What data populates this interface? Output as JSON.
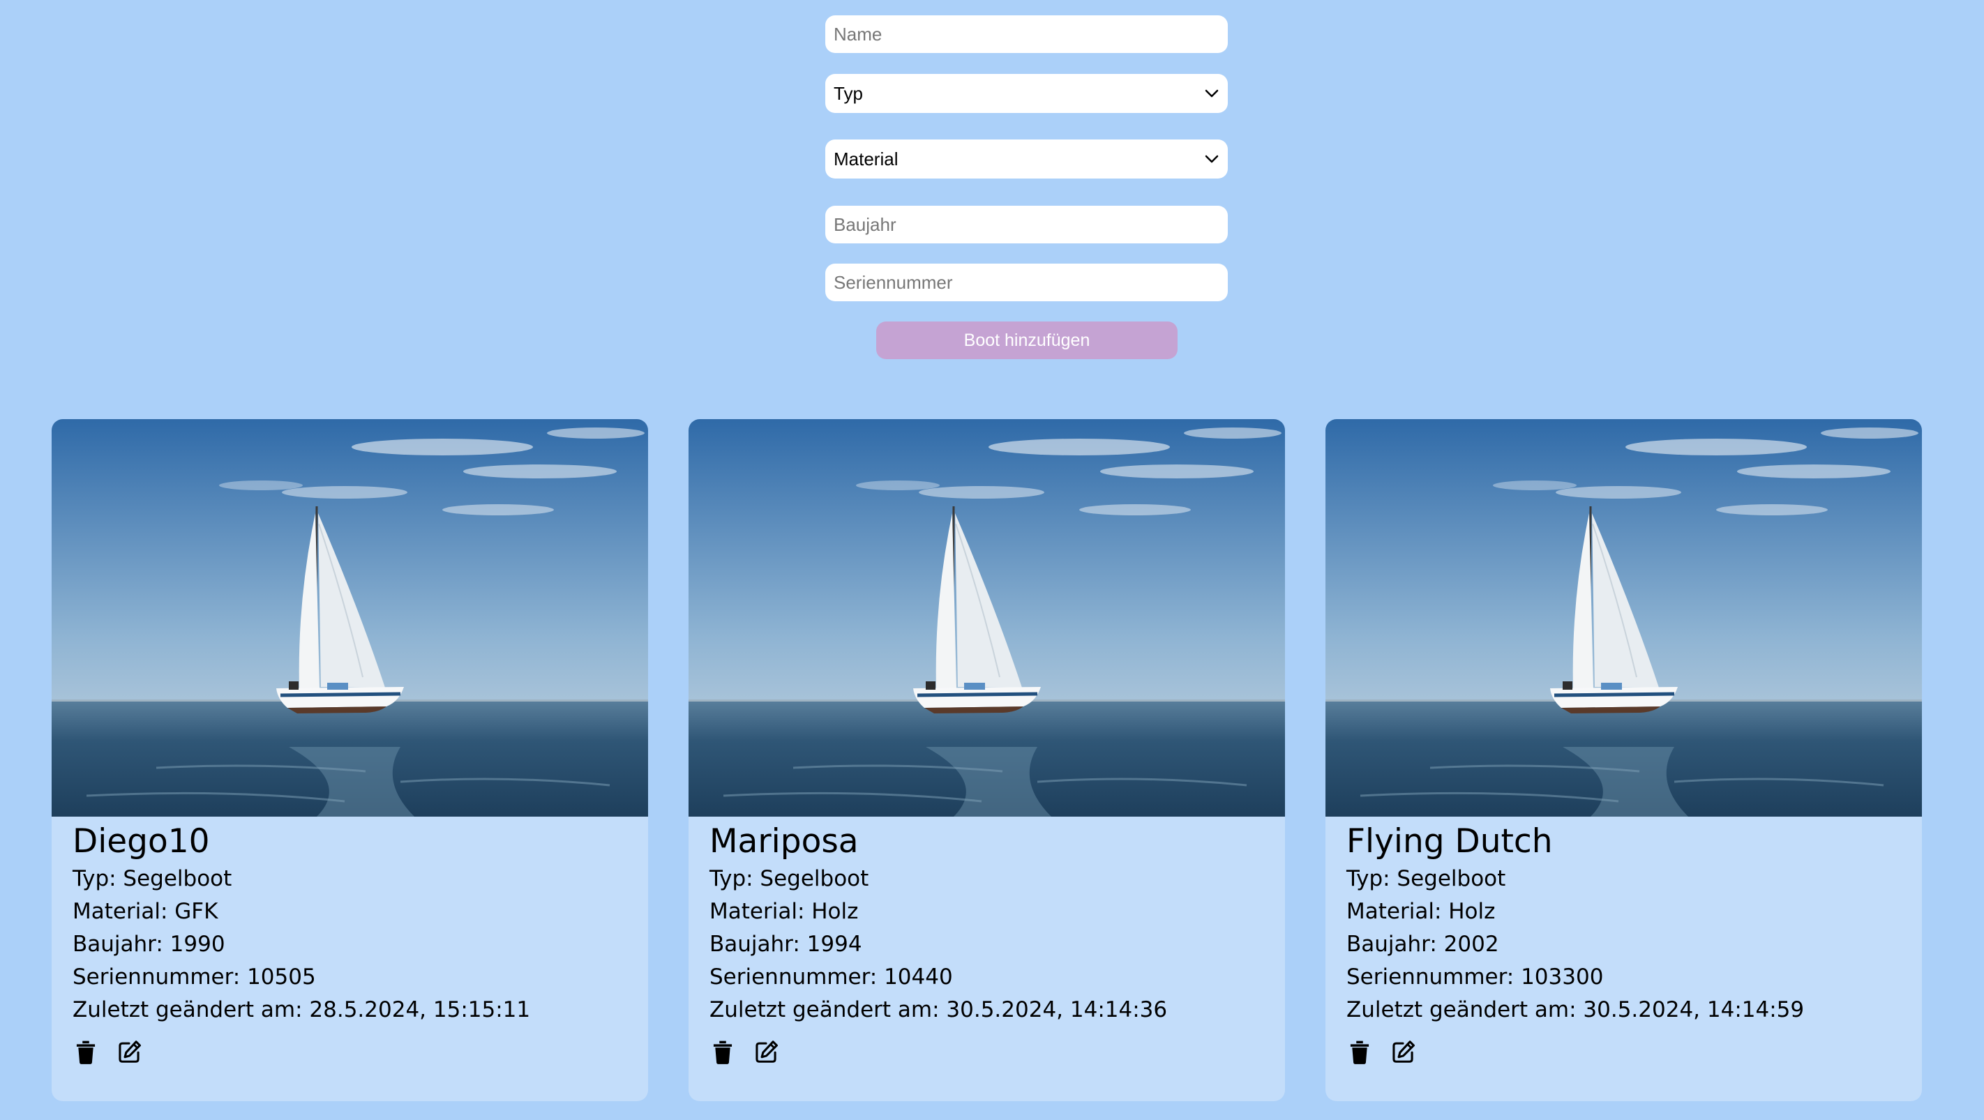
{
  "form": {
    "name_placeholder": "Name",
    "type_select": "Typ",
    "material_select": "Material",
    "year_placeholder": "Baujahr",
    "serial_placeholder": "Seriennummer",
    "submit_label": "Boot hinzufügen"
  },
  "colors": {
    "background": "#abd0f9",
    "card": "#c3ddfa",
    "button": "#c5a3d3"
  },
  "boats": [
    {
      "name": "Diego10",
      "type": "Typ: Segelboot",
      "material": "Material: GFK",
      "year": "Baujahr: 1990",
      "serial": "Seriennummer: 10505",
      "modified": "Zuletzt geändert am: 28.5.2024, 15:15:11"
    },
    {
      "name": "Mariposa",
      "type": "Typ: Segelboot",
      "material": "Material: Holz",
      "year": "Baujahr: 1994",
      "serial": "Seriennummer: 10440",
      "modified": "Zuletzt geändert am: 30.5.2024, 14:14:36"
    },
    {
      "name": "Flying Dutch",
      "type": "Typ: Segelboot",
      "material": "Material: Holz",
      "year": "Baujahr: 2002",
      "serial": "Seriennummer: 103300",
      "modified": "Zuletzt geändert am: 30.5.2024, 14:14:59"
    }
  ],
  "icons": {
    "delete": "trash-icon",
    "edit": "edit-icon"
  }
}
